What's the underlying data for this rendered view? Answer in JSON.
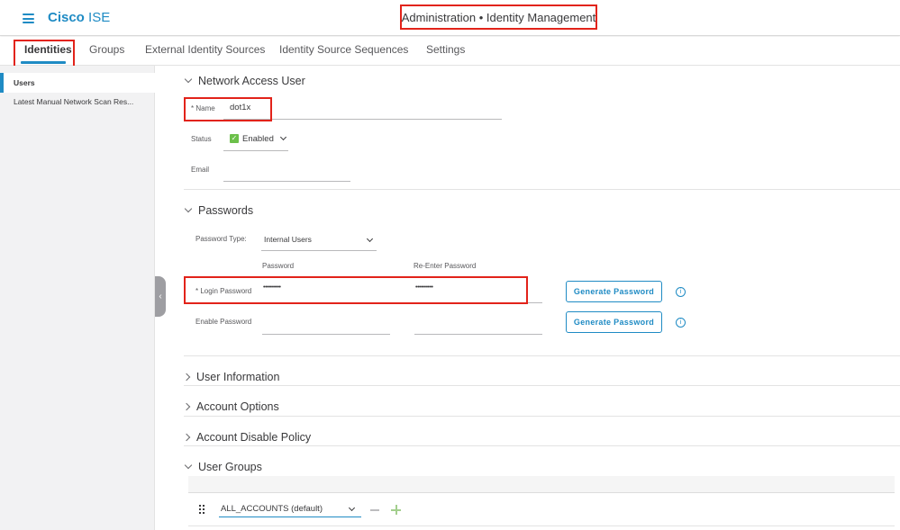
{
  "header": {
    "brand_bold": "Cisco",
    "brand_light": "ISE",
    "title": "Administration • Identity Management"
  },
  "tabs": [
    {
      "label": "Identities",
      "active": true
    },
    {
      "label": "Groups"
    },
    {
      "label": "External Identity Sources"
    },
    {
      "label": "Identity Source Sequences"
    },
    {
      "label": "Settings"
    }
  ],
  "sidebar": {
    "items": [
      {
        "label": "Users",
        "active": true
      },
      {
        "label": "Latest Manual Network Scan Res..."
      }
    ]
  },
  "network_access_user": {
    "heading": "Network Access User",
    "name_label": "* Name",
    "name_value": "dot1x",
    "status_label": "Status",
    "status_value": "Enabled",
    "email_label": "Email",
    "email_value": ""
  },
  "passwords": {
    "heading": "Passwords",
    "type_label": "Password Type:",
    "type_value": "Internal Users",
    "col_password": "Password",
    "col_reenter": "Re-Enter Password",
    "login_label": "* Login Password",
    "login_value": "••••••••••",
    "login_reenter_value": "••••••••••",
    "enable_label": "Enable Password",
    "enable_value": "",
    "enable_reenter_value": "",
    "generate_label": "Generate Password",
    "info_glyph": "i"
  },
  "collapsed_sections": [
    {
      "label": "User Information"
    },
    {
      "label": "Account Options"
    },
    {
      "label": "Account Disable Policy"
    }
  ],
  "user_groups": {
    "heading": "User Groups",
    "selected_group": "ALL_ACCOUNTS (default)"
  },
  "colors": {
    "accent": "#1f8bc4",
    "highlight": "#e2231a",
    "enabled_green": "#6cc04a"
  },
  "icons": {
    "collapse_arrow": "‹",
    "check": "✓"
  }
}
